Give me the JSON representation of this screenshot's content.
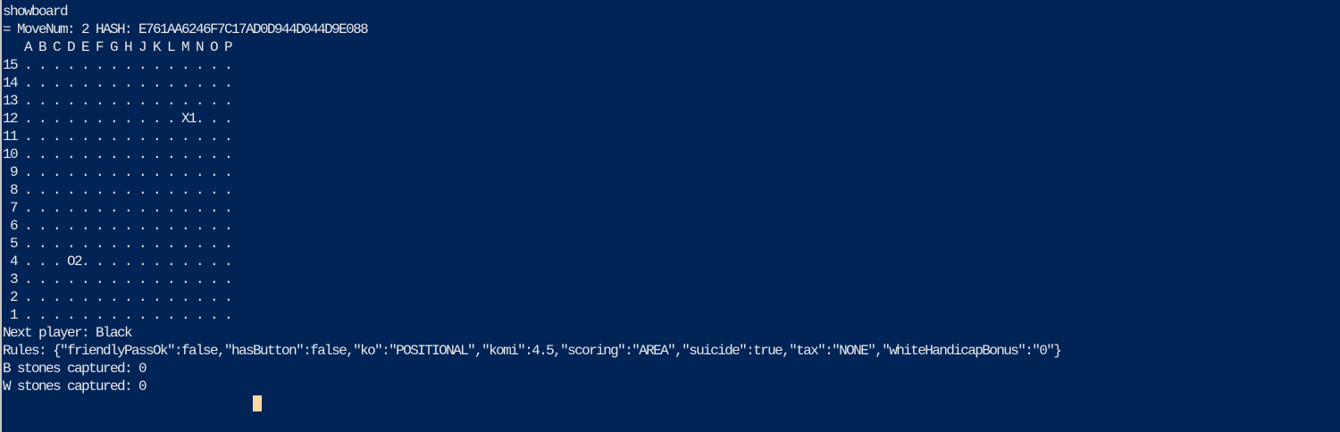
{
  "terminal": {
    "lines": [
      "showboard",
      "= MoveNum: 2 HASH: E761AA6246F7C17AD0D944D044D9E088",
      "   A B C D E F G H J K L M N O P",
      "15 . . . . . . . . . . . . . . .",
      "14 . . . . . . . . . . . . . . .",
      "13 . . . . . . . . . . . . . . .",
      "12 . . . . . . . . . . . X1. . .",
      "11 . . . . . . . . . . . . . . .",
      "10 . . . . . . . . . . . . . . .",
      " 9 . . . . . . . . . . . . . . .",
      " 8 . . . . . . . . . . . . . . .",
      " 7 . . . . . . . . . . . . . . .",
      " 6 . . . . . . . . . . . . . . .",
      " 5 . . . . . . . . . . . . . . .",
      " 4 . . . O2. . . . . . . . . . .",
      " 3 . . . . . . . . . . . . . . .",
      " 2 . . . . . . . . . . . . . . .",
      " 1 . . . . . . . . . . . . . . .",
      "Next player: Black",
      "Rules: {\"friendlyPassOk\":false,\"hasButton\":false,\"ko\":\"POSITIONAL\",\"komi\":4.5,\"scoring\":\"AREA\",\"suicide\":true,\"tax\":\"NONE\",\"whiteHandicapBonus\":\"0\"}",
      "B stones captured: 0",
      "W stones captured: 0"
    ]
  },
  "colors": {
    "background": "#012456",
    "text": "#e8e8e8",
    "cursor": "#fcd8a4"
  }
}
